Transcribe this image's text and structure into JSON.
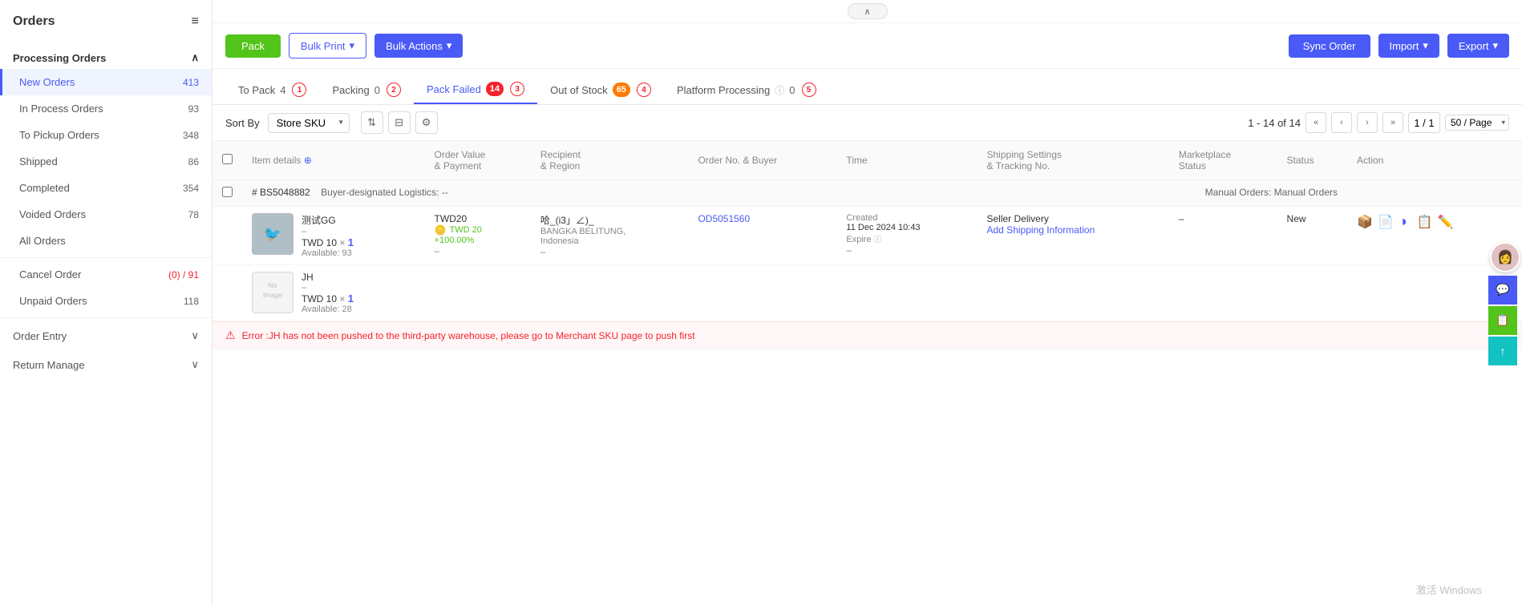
{
  "sidebar": {
    "title": "Orders",
    "sections": [
      {
        "name": "Processing Orders",
        "expanded": true,
        "items": [
          {
            "label": "New Orders",
            "count": "413",
            "active": true,
            "countType": "normal"
          },
          {
            "label": "In Process Orders",
            "count": "93",
            "countType": "normal"
          },
          {
            "label": "To Pickup Orders",
            "count": "348",
            "countType": "normal"
          },
          {
            "label": "Shipped",
            "count": "86",
            "countType": "normal"
          },
          {
            "label": "Completed",
            "count": "354",
            "countType": "normal"
          },
          {
            "label": "Voided Orders",
            "count": "78",
            "countType": "normal"
          },
          {
            "label": "All Orders",
            "count": "",
            "countType": "normal"
          }
        ]
      }
    ],
    "extra_items": [
      {
        "label": "Cancel Order",
        "count": "(0) / 91",
        "countType": "red"
      },
      {
        "label": "Unpaid Orders",
        "count": "118",
        "countType": "normal"
      }
    ],
    "bottom_sections": [
      {
        "label": "Order Entry",
        "expanded": false
      },
      {
        "label": "Return Manage",
        "expanded": false
      }
    ]
  },
  "toolbar": {
    "pack_label": "Pack",
    "bulk_print_label": "Bulk Print",
    "bulk_actions_label": "Bulk Actions",
    "sync_order_label": "Sync Order",
    "import_label": "Import",
    "export_label": "Export"
  },
  "tabs": [
    {
      "label": "To Pack",
      "count": "4",
      "badge_type": "circle",
      "number": "1"
    },
    {
      "label": "Packing",
      "count": "0",
      "badge_type": "circle",
      "number": "2"
    },
    {
      "label": "Pack Failed",
      "count": "14",
      "badge_type": "red",
      "number": "3"
    },
    {
      "label": "Out of Stock",
      "count": "65",
      "badge_type": "orange",
      "number": "4"
    },
    {
      "label": "Platform Processing",
      "count": "0",
      "badge_type": "circle",
      "number": "5",
      "has_info": true
    }
  ],
  "filter": {
    "sort_by_label": "Sort By",
    "sort_option": "Store SKU"
  },
  "pagination": {
    "range": "1 - 14 of 14",
    "current_page": "1 / 1",
    "page_size": "50 / Page"
  },
  "table": {
    "columns": [
      "Item details",
      "Order Value & Payment",
      "Recipient & Region",
      "Order No. & Buyer",
      "Time",
      "Shipping Settings & Tracking No.",
      "Marketplace Status",
      "Status",
      "Action"
    ],
    "rows": [
      {
        "order_id": "# BS5048882",
        "logistics": "Buyer-designated Logistics: --",
        "order_type": "Manual Orders: Manual Orders",
        "items": [
          {
            "name": "测试GG",
            "sku": "–",
            "price_twd": "TWD 10",
            "qty": "1",
            "available": "Available: 93",
            "order_value": "TWD20",
            "order_value_alt": "TWD 20",
            "order_percent": "+100.00%",
            "order_dash": "–",
            "recipient": "哈_(i3」∠)_",
            "region": "BANGKA BELITUNG, Indonesia",
            "region_dash": "–",
            "order_no": "OD5051560",
            "created_label": "Created",
            "created_time": "11 Dec 2024 10:43",
            "expire_label": "Expire",
            "expire_value": "–",
            "shipping_type": "Seller Delivery",
            "shipping_link": "Add Shipping Information",
            "marketplace_status": "–",
            "status": "New"
          },
          {
            "name": "JH",
            "sku": "–",
            "price_twd": "TWD 10",
            "qty": "1",
            "available": "Available: 28",
            "order_value": "",
            "order_value_alt": "",
            "order_percent": "",
            "recipient": "",
            "region": "",
            "order_no": "",
            "created_label": "",
            "created_time": "",
            "expire_label": "",
            "expire_value": "",
            "shipping_type": "",
            "shipping_link": "",
            "marketplace_status": "",
            "status": ""
          }
        ],
        "error": "Error :JH has not been pushed to the third-party warehouse, please go to Merchant SKU page to push first"
      }
    ]
  },
  "watermark": "激活 Windows",
  "icons": {
    "menu": "≡",
    "chevron_up": "∧",
    "chevron_down": "∨",
    "chevron_left": "<",
    "chevron_right": ">",
    "double_left": "«",
    "double_right": "»",
    "sort": "⇅",
    "filter": "⊟",
    "settings": "⚙",
    "plus": "+",
    "box": "📦",
    "doc": "📄",
    "chat": "💬",
    "edit": "✏",
    "error": "⚠",
    "info": "ⓘ"
  }
}
